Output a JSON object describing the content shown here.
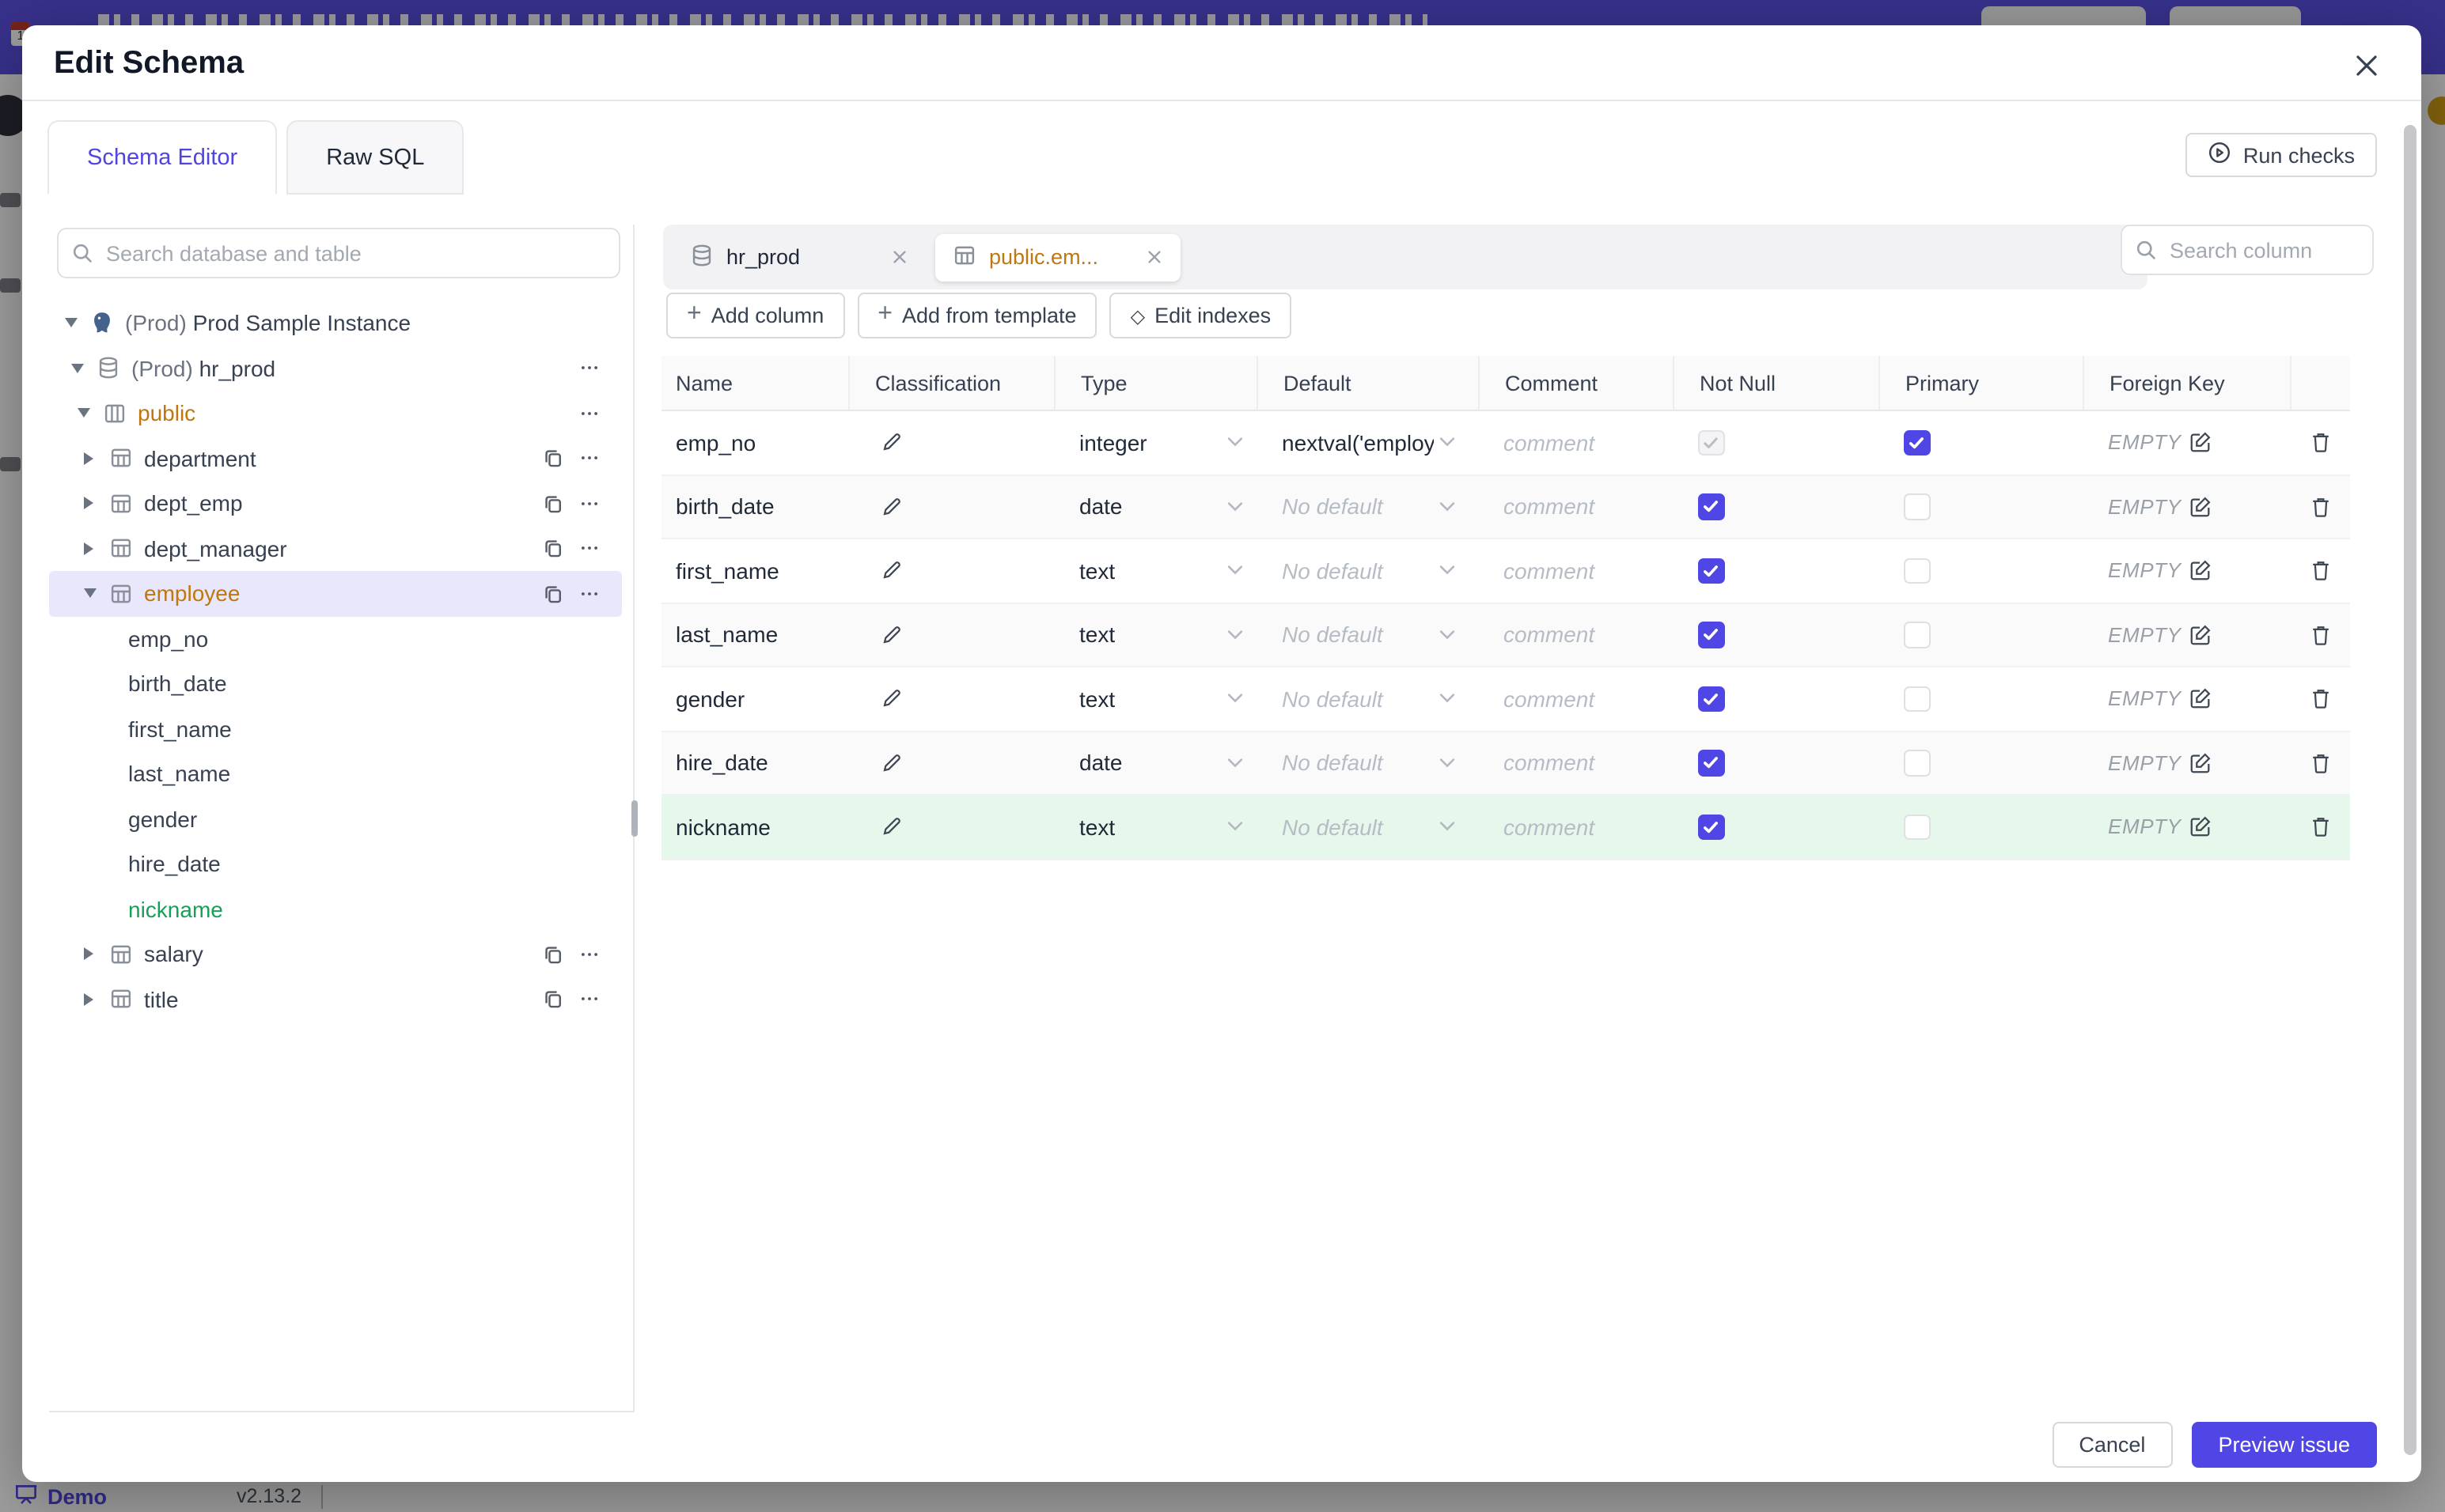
{
  "modal": {
    "title": "Edit Schema",
    "run_checks_label": "Run checks",
    "tabs": [
      {
        "label": "Schema Editor",
        "active": true
      },
      {
        "label": "Raw SQL",
        "active": false
      }
    ],
    "sidebar": {
      "search_placeholder": "Search database and table",
      "tree": [
        {
          "level": 1,
          "caret": "down",
          "icon": "postgres",
          "prefix": "(Prod)",
          "label": "Prod Sample Instance"
        },
        {
          "level": 2,
          "caret": "down",
          "icon": "database",
          "prefix": "(Prod)",
          "label": "hr_prod",
          "actions": [
            "more"
          ]
        },
        {
          "level": 3,
          "caret": "down",
          "icon": "schema",
          "label": "public",
          "color": "amber",
          "actions": [
            "more"
          ]
        },
        {
          "level": 4,
          "caret": "right",
          "icon": "table",
          "label": "department",
          "actions": [
            "copy",
            "more"
          ]
        },
        {
          "level": 4,
          "caret": "right",
          "icon": "table",
          "label": "dept_emp",
          "actions": [
            "copy",
            "more"
          ]
        },
        {
          "level": 4,
          "caret": "right",
          "icon": "table",
          "label": "dept_manager",
          "actions": [
            "copy",
            "more"
          ]
        },
        {
          "level": 4,
          "caret": "down",
          "icon": "table",
          "label": "employee",
          "color": "amber",
          "selected": true,
          "actions": [
            "copy",
            "more"
          ]
        },
        {
          "level": 5,
          "label": "emp_no"
        },
        {
          "level": 5,
          "label": "birth_date"
        },
        {
          "level": 5,
          "label": "first_name"
        },
        {
          "level": 5,
          "label": "last_name"
        },
        {
          "level": 5,
          "label": "gender"
        },
        {
          "level": 5,
          "label": "hire_date"
        },
        {
          "level": 5,
          "label": "nickname",
          "color": "green"
        },
        {
          "level": 4,
          "caret": "right",
          "icon": "table",
          "label": "salary",
          "actions": [
            "copy",
            "more"
          ]
        },
        {
          "level": 4,
          "caret": "right",
          "icon": "table",
          "label": "title",
          "actions": [
            "copy",
            "more"
          ]
        }
      ]
    },
    "main": {
      "db_tabs": [
        {
          "icon": "database",
          "label": "hr_prod",
          "active": false
        },
        {
          "icon": "table",
          "label": "public.em...",
          "active": true
        }
      ],
      "column_search_placeholder": "Search column",
      "actions": [
        {
          "icon": "plus",
          "label": "Add column"
        },
        {
          "icon": "plus",
          "label": "Add from template"
        },
        {
          "icon": "diamond",
          "label": "Edit indexes"
        }
      ],
      "table": {
        "headers": [
          "Name",
          "Classification",
          "Type",
          "Default",
          "Comment",
          "Not Null",
          "Primary",
          "Foreign Key",
          ""
        ],
        "comment_placeholder": "comment",
        "no_default_placeholder": "No default",
        "foreign_key_label": "EMPTY",
        "rows": [
          {
            "name": "emp_no",
            "type": "integer",
            "default_value": "nextval('employ",
            "not_null_checked": true,
            "not_null_disabled": true,
            "primary": true
          },
          {
            "name": "birth_date",
            "type": "date",
            "default_value": null,
            "not_null_checked": true,
            "not_null_disabled": false,
            "primary": false
          },
          {
            "name": "first_name",
            "type": "text",
            "default_value": null,
            "not_null_checked": true,
            "not_null_disabled": false,
            "primary": false
          },
          {
            "name": "last_name",
            "type": "text",
            "default_value": null,
            "not_null_checked": true,
            "not_null_disabled": false,
            "primary": false
          },
          {
            "name": "gender",
            "type": "text",
            "default_value": null,
            "not_null_checked": true,
            "not_null_disabled": false,
            "primary": false
          },
          {
            "name": "hire_date",
            "type": "date",
            "default_value": null,
            "not_null_checked": true,
            "not_null_disabled": false,
            "primary": false
          },
          {
            "name": "nickname",
            "type": "text",
            "default_value": null,
            "not_null_checked": true,
            "not_null_disabled": false,
            "primary": false,
            "highlight": "green"
          }
        ]
      }
    },
    "footer": {
      "cancel_label": "Cancel",
      "primary_label": "Preview issue"
    }
  },
  "statusbar": {
    "demo_label": "Demo",
    "version": "v2.13.2"
  },
  "colors": {
    "accent": "#4f46e5",
    "amber_text": "#c0770f",
    "green_text": "#18a058",
    "green_row_bg": "#e6f7ec",
    "selected_row_bg": "#e9e7fb",
    "topbar_purple": "#5a50e0",
    "avatar_gold": "#d4a016"
  }
}
